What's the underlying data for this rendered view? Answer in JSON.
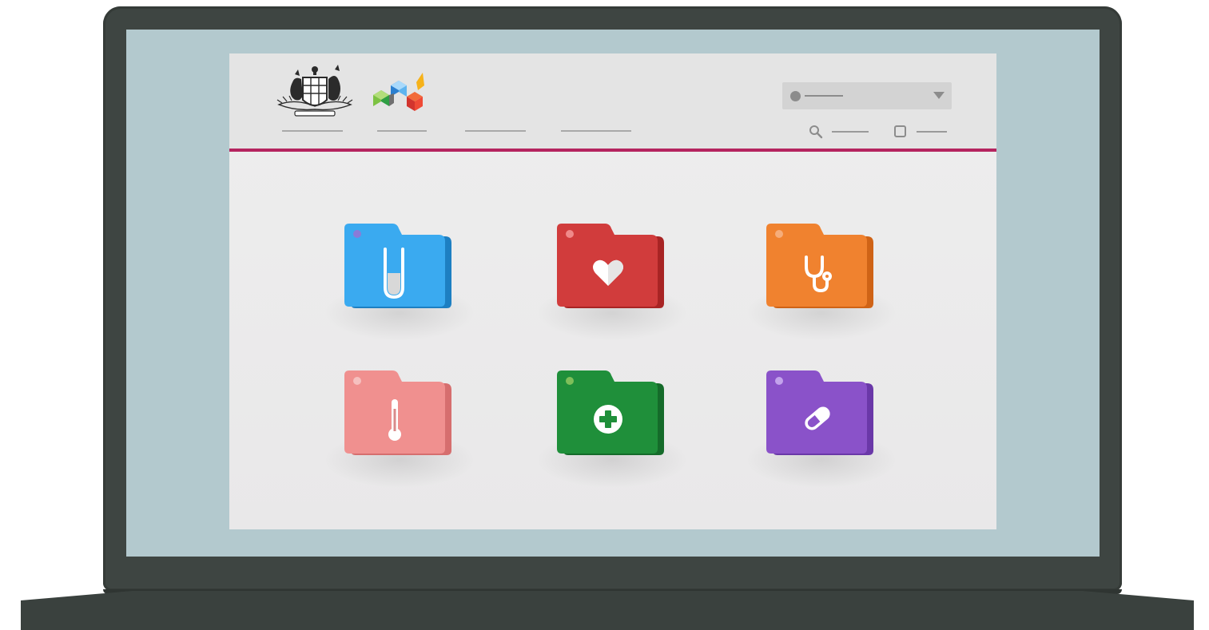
{
  "colors": {
    "accent_rule": "#b5245f",
    "laptop_frame": "#3e4542",
    "screen_background": "#b3c9ce",
    "page_background": "#ececec"
  },
  "header": {
    "crest": "coat-of-arms-icon",
    "brandmark": "cube-logo-icon",
    "nav": [
      {
        "name": "nav-link-1"
      },
      {
        "name": "nav-link-2"
      },
      {
        "name": "nav-link-3"
      },
      {
        "name": "nav-link-4"
      }
    ],
    "dropdown": {
      "icon": "user-dot-icon",
      "caret": "chevron-down-icon"
    },
    "utilities": [
      {
        "icon": "search-icon"
      },
      {
        "icon": "square-icon"
      }
    ]
  },
  "folders": [
    {
      "color": "#3aaaf0",
      "icon": "test-tube-icon"
    },
    {
      "color": "#d13c3c",
      "icon": "heart-icon"
    },
    {
      "color": "#f0822f",
      "icon": "stethoscope-icon"
    },
    {
      "color": "#f0908f",
      "icon": "thermometer-icon"
    },
    {
      "color": "#1f8f3a",
      "icon": "medical-plus-icon"
    },
    {
      "color": "#8a52c9",
      "icon": "pill-icon"
    }
  ]
}
